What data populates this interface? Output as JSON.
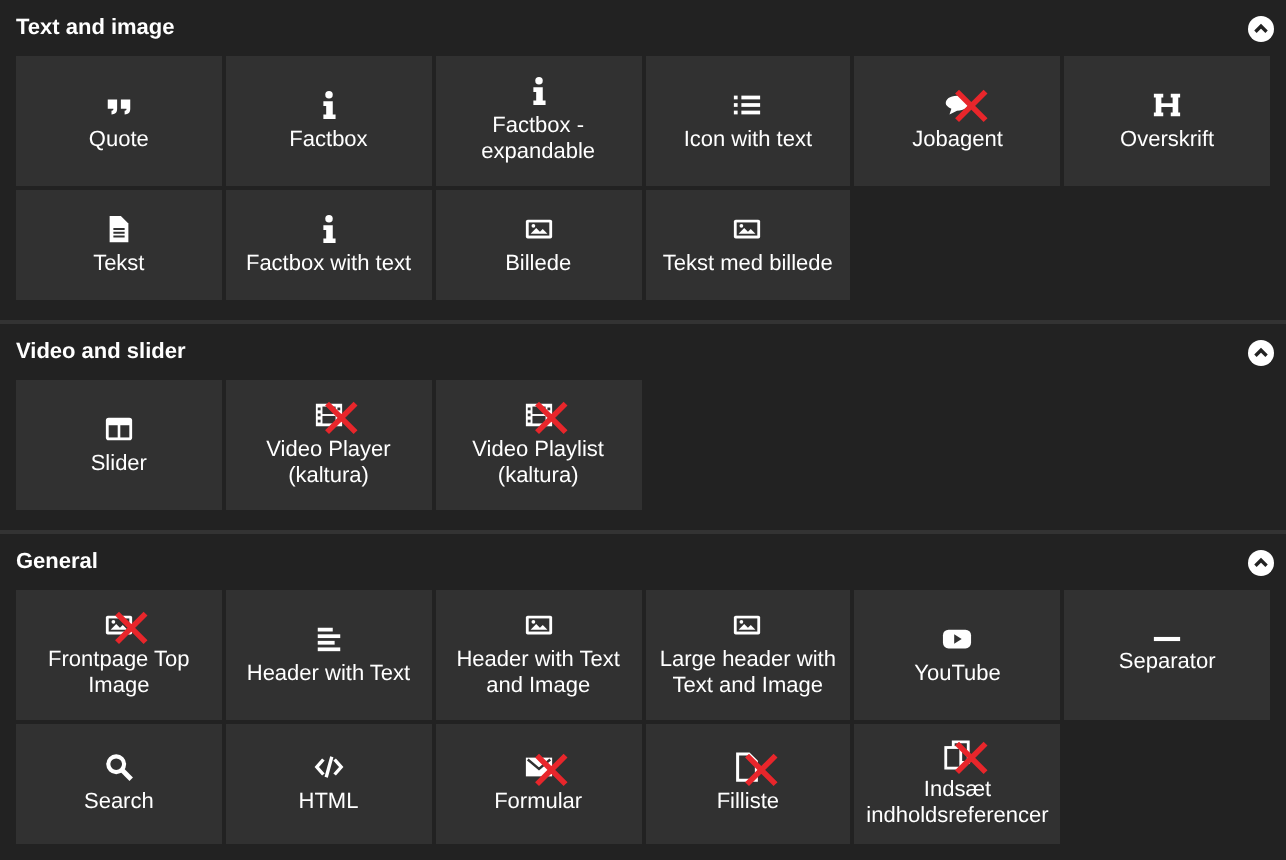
{
  "sections": [
    {
      "title": "Text and image",
      "expanded": true,
      "tiles": [
        {
          "label": "Quote",
          "kind": "quote",
          "crossed": false
        },
        {
          "label": "Factbox",
          "kind": "info",
          "crossed": false
        },
        {
          "label": "Factbox - expandable",
          "kind": "info",
          "crossed": false
        },
        {
          "label": "Icon with text",
          "kind": "list",
          "crossed": false
        },
        {
          "label": "Jobagent",
          "kind": "chat",
          "crossed": true
        },
        {
          "label": "Overskrift",
          "kind": "heading",
          "crossed": false
        },
        {
          "label": "Tekst",
          "kind": "document",
          "crossed": false
        },
        {
          "label": "Factbox with text",
          "kind": "info",
          "crossed": false
        },
        {
          "label": "Billede",
          "kind": "image",
          "crossed": false
        },
        {
          "label": "Tekst med billede",
          "kind": "image",
          "crossed": false
        }
      ]
    },
    {
      "title": "Video and slider",
      "expanded": true,
      "tiles": [
        {
          "label": "Slider",
          "kind": "columns",
          "crossed": false
        },
        {
          "label": "Video Player (kaltura)",
          "kind": "film",
          "crossed": true
        },
        {
          "label": "Video Playlist (kaltura)",
          "kind": "film",
          "crossed": true
        }
      ]
    },
    {
      "title": "General",
      "expanded": true,
      "tiles": [
        {
          "label": "Frontpage Top Image",
          "kind": "image",
          "crossed": true
        },
        {
          "label": "Header with Text",
          "kind": "lines",
          "crossed": false
        },
        {
          "label": "Header with Text and Image",
          "kind": "image",
          "crossed": false
        },
        {
          "label": "Large header with Text and Image",
          "kind": "image",
          "crossed": false
        },
        {
          "label": "YouTube",
          "kind": "youtube",
          "crossed": false
        },
        {
          "label": "Separator",
          "kind": "dash",
          "crossed": false
        },
        {
          "label": "Search",
          "kind": "search",
          "crossed": false
        },
        {
          "label": "HTML",
          "kind": "code",
          "crossed": false
        },
        {
          "label": "Formular",
          "kind": "envelope",
          "crossed": true
        },
        {
          "label": "Filliste",
          "kind": "file",
          "crossed": true
        },
        {
          "label": "Indsæt indholdsreferencer",
          "kind": "copy",
          "crossed": true
        }
      ]
    }
  ]
}
